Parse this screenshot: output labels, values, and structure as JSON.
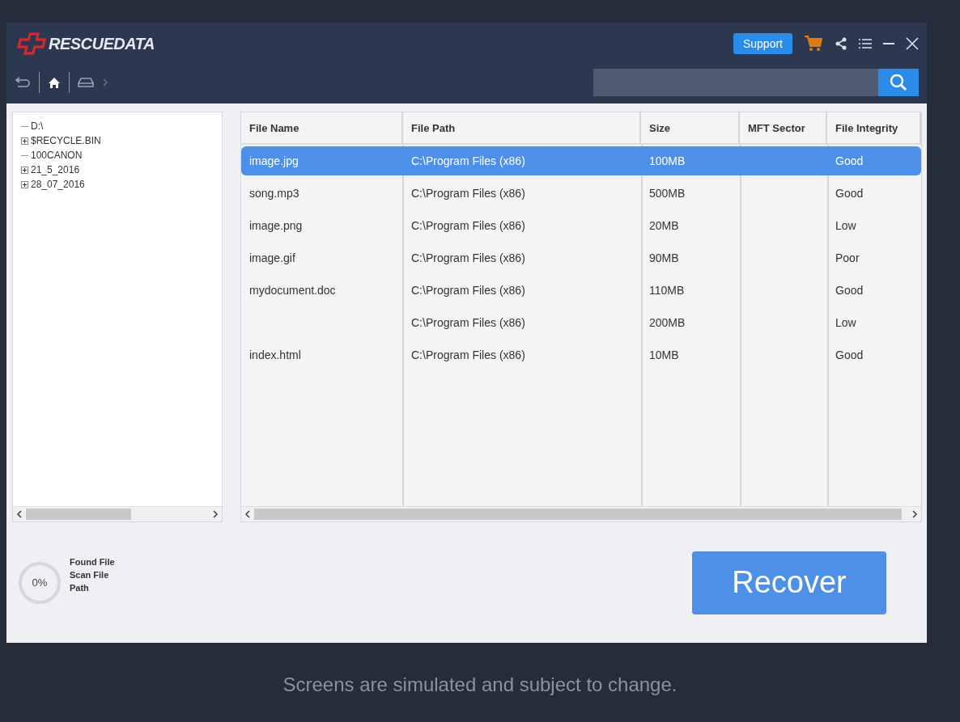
{
  "app": {
    "logo": "RESCUEDATA"
  },
  "header_buttons": [
    {
      "label": "Support"
    }
  ],
  "tree": [
    {
      "label": "D:\\",
      "collapsed": false,
      "children": [
        {
          "label": "$RECYCLE.BIN",
          "collapsed": true
        },
        {
          "label": "100CANON",
          "collapsed": false
        },
        {
          "label": "21_5_2016",
          "collapsed": true
        },
        {
          "label": "28_07_2016",
          "collapsed": true
        }
      ]
    }
  ],
  "table": {
    "columns": [
      "File Name",
      "File Path",
      "Size",
      "MFT Sector",
      "File Integrity"
    ],
    "rows": [
      {
        "name": "image.jpg",
        "path": "C:\\Program Files (x86)",
        "size": "100MB",
        "integrity": "Good",
        "selected": true
      },
      {
        "name": "song.mp3",
        "path": "C:\\Program Files (x86)",
        "size": "500MB",
        "integrity": "Good",
        "selected": false
      },
      {
        "name": "image.png",
        "path": "C:\\Program Files (x86)",
        "size": "20MB",
        "integrity": "Low",
        "selected": false
      },
      {
        "name": "image.gif",
        "path": "C:\\Program Files (x86)",
        "size": "90MB",
        "integrity": "Poor",
        "selected": false
      },
      {
        "name": "mydocument.doc",
        "path": "C:\\Program Files (x86)",
        "size": "110MB",
        "integrity": "Good",
        "selected": false
      },
      {
        "path": "C:\\Program Files (x86)",
        "size": "200MB",
        "integrity": "Low",
        "selected": false
      },
      {
        "name": "index.html",
        "path": "C:\\Program Files (x86)",
        "size": "10MB",
        "integrity": "Good",
        "selected": false
      }
    ]
  },
  "scan": {
    "percent": "0%",
    "level": 0,
    "labels": [
      "Found File",
      "Scan File",
      "Path"
    ]
  },
  "recover_button": "Recover",
  "caption": "Screens are simulated and subject to change."
}
